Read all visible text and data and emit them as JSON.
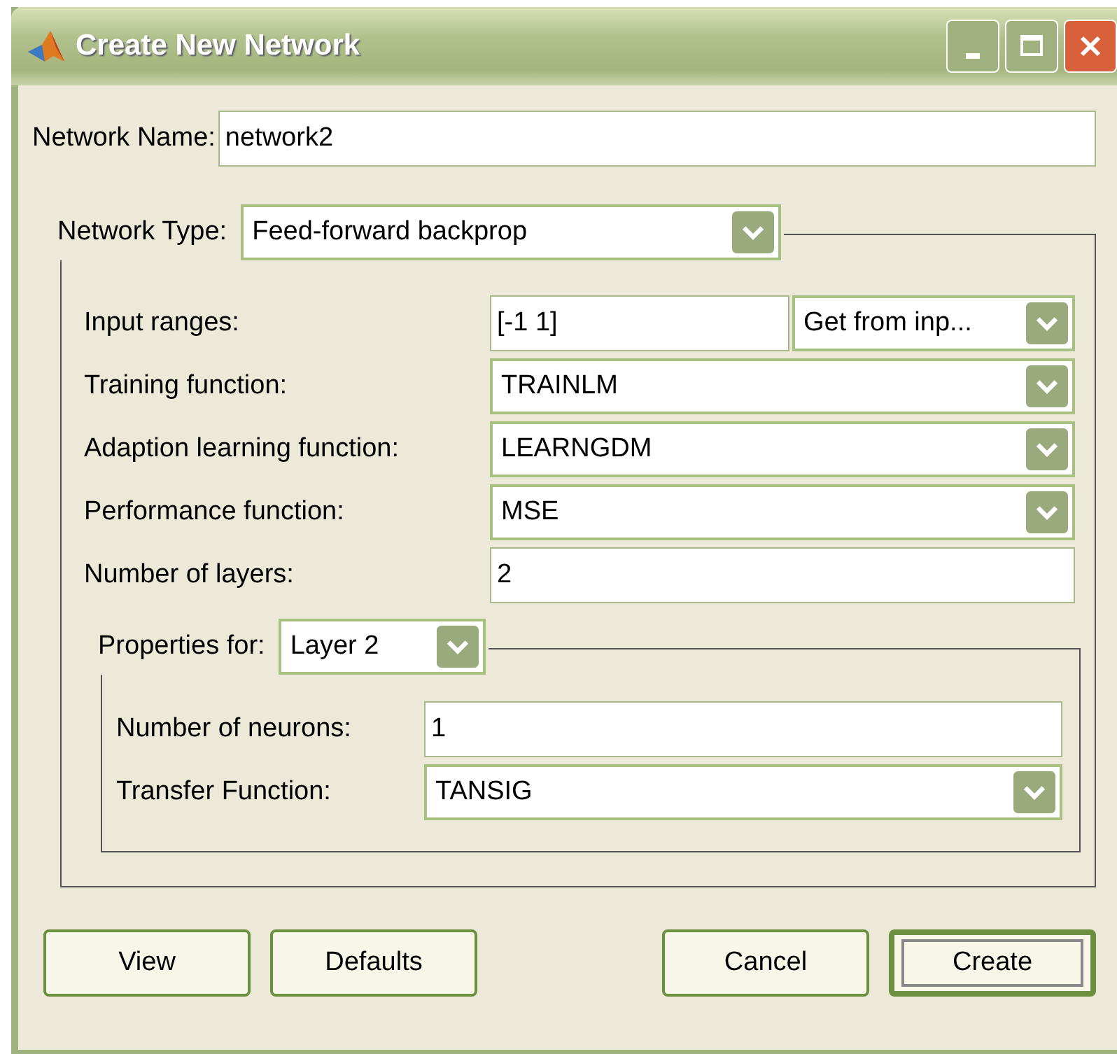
{
  "window": {
    "title": "Create New Network"
  },
  "network_name": {
    "label": "Network Name:",
    "value": "network2"
  },
  "network_type": {
    "label": "Network Type:",
    "value": "Feed-forward backprop"
  },
  "parameters": [
    {
      "kind": "text_dropdown",
      "label": "Input ranges:",
      "value": "[-1 1]",
      "option": "Get from inp..."
    },
    {
      "kind": "dropdown",
      "label": "Training function:",
      "value": "TRAINLM"
    },
    {
      "kind": "dropdown",
      "label": "Adaption learning function:",
      "value": "LEARNGDM"
    },
    {
      "kind": "dropdown",
      "label": "Performance function:",
      "value": "MSE"
    },
    {
      "kind": "text",
      "label": "Number of layers:",
      "value": "2"
    }
  ],
  "layer_properties": {
    "label": "Properties for:",
    "value": "Layer 2",
    "fields": [
      {
        "kind": "text",
        "label": "Number of neurons:",
        "value": "1"
      },
      {
        "kind": "dropdown",
        "label": "Transfer Function:",
        "value": "TANSIG"
      }
    ]
  },
  "buttons": [
    {
      "label": "View",
      "default": false
    },
    {
      "label": "Defaults",
      "default": false
    },
    {
      "label": "Cancel",
      "default": false
    },
    {
      "label": "Create",
      "default": true
    }
  ]
}
